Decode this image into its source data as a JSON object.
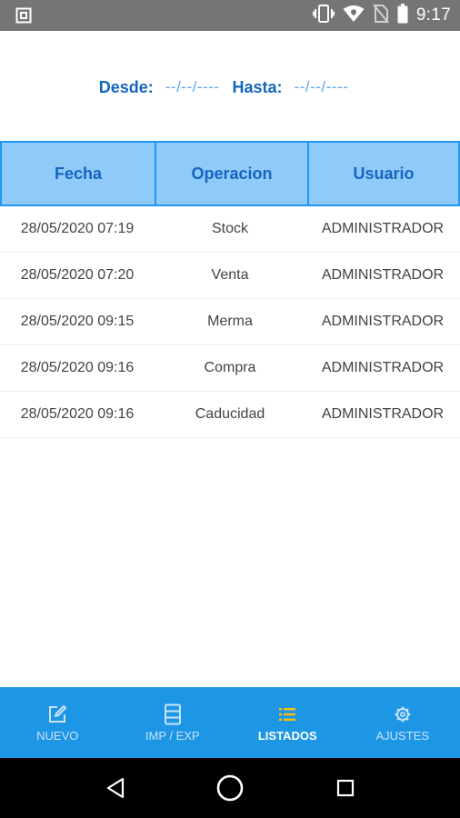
{
  "status_bar": {
    "time": "9:17",
    "icons": [
      "screenshot-icon",
      "vibrate-icon",
      "wifi-icon",
      "no-sim-icon",
      "battery-icon"
    ]
  },
  "filter": {
    "from_label": "Desde:",
    "from_value": "--/--/----",
    "to_label": "Hasta:",
    "to_value": "--/--/----"
  },
  "table": {
    "headers": [
      "Fecha",
      "Operacion",
      "Usuario"
    ],
    "rows": [
      {
        "fecha": "28/05/2020 07:19",
        "operacion": "Stock",
        "usuario": "ADMINISTRADOR"
      },
      {
        "fecha": "28/05/2020 07:20",
        "operacion": "Venta",
        "usuario": "ADMINISTRADOR"
      },
      {
        "fecha": "28/05/2020 09:15",
        "operacion": "Merma",
        "usuario": "ADMINISTRADOR"
      },
      {
        "fecha": "28/05/2020 09:16",
        "operacion": "Compra",
        "usuario": "ADMINISTRADOR"
      },
      {
        "fecha": "28/05/2020 09:16",
        "operacion": "Caducidad",
        "usuario": "ADMINISTRADOR"
      }
    ]
  },
  "bottom_nav": {
    "items": [
      {
        "label": "NUEVO",
        "icon": "edit-icon",
        "active": false
      },
      {
        "label": "IMP / EXP",
        "icon": "database-icon",
        "active": false
      },
      {
        "label": "LISTADOS",
        "icon": "list-icon",
        "active": true
      },
      {
        "label": "AJUSTES",
        "icon": "gear-icon",
        "active": false
      }
    ]
  },
  "colors": {
    "accent": "#1e96e6",
    "header_bg": "#90caf9",
    "header_text": "#1565c0",
    "active_icon": "#ffc107"
  }
}
